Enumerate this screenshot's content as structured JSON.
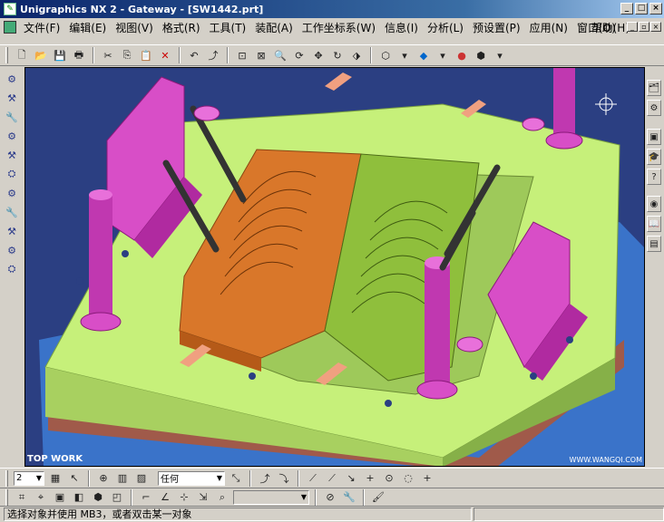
{
  "window": {
    "title": "Unigraphics NX 2 - Gateway - [SW1442.prt]"
  },
  "menu": {
    "items": [
      "文件(F)",
      "编辑(E)",
      "视图(V)",
      "格式(R)",
      "工具(T)",
      "装配(A)",
      "工作坐标系(W)",
      "信息(I)",
      "分析(L)",
      "预设置(P)",
      "应用(N)",
      "窗口(O)"
    ],
    "help": "帮助(H)"
  },
  "viewport": {
    "label": "TOP WORK",
    "watermark": "WWW.WANGQI.COM"
  },
  "toolbar2": {
    "layer_value": "2",
    "filter_value": "任何"
  },
  "status": {
    "message": "选择对象并使用 MB3，或者双击某一对象"
  },
  "colors": {
    "background": "#2b3f82",
    "plate": "#c6f07a",
    "insert_orange": "#d9772a",
    "insert_green": "#8fbf3c",
    "slider_magenta": "#d84ec7"
  }
}
